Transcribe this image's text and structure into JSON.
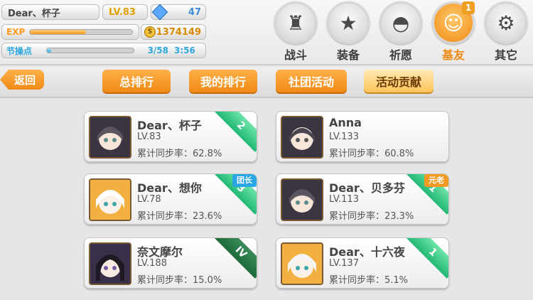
{
  "player": {
    "name": "Dear、杯子",
    "level": "LV.83",
    "gems": "47",
    "exp_label": "EXP",
    "exp_fraction": 0.55,
    "coins": "1374149",
    "stamina_label": "节操点",
    "stamina_fraction": 0.05,
    "stamina_value": "3/58",
    "stamina_timer": "3:56"
  },
  "nav": [
    {
      "label": "战斗",
      "icon": "castle-icon"
    },
    {
      "label": "装备",
      "icon": "star-gun-icon"
    },
    {
      "label": "祈愿",
      "icon": "egg-icon"
    },
    {
      "label": "基友",
      "icon": "friend-icon",
      "badge": "1"
    },
    {
      "label": "其它",
      "icon": "gear-icon"
    }
  ],
  "back_label": "返回",
  "tabs": [
    {
      "label": "总排行"
    },
    {
      "label": "我的排行"
    },
    {
      "label": "社团活动"
    },
    {
      "label": "活动贡献"
    }
  ],
  "members": [
    {
      "name": "Dear、杯子",
      "level": "LV.83",
      "rate": "累计同步率：62.8%",
      "rank": "2",
      "badge": ""
    },
    {
      "name": "Anna",
      "level": "LV.133",
      "rate": "累计同步率：60.8%",
      "rank": "",
      "badge": ""
    },
    {
      "name": "Dear、想你",
      "level": "LV.78",
      "rate": "累计同步率：23.6%",
      "rank": "3",
      "badge": "团长"
    },
    {
      "name": "Dear、贝多芬",
      "level": "LV.113",
      "rate": "累计同步率：23.3%",
      "rank": "1",
      "badge": "元老"
    },
    {
      "name": "奈文摩尔",
      "level": "LV.188",
      "rate": "累计同步率：15.0%",
      "rank": "IV",
      "badge": ""
    },
    {
      "name": "Dear、十六夜",
      "level": "LV.137",
      "rate": "累计同步率：5.1%",
      "rank": "1",
      "badge": ""
    }
  ],
  "colors": {
    "accent_orange": "#f08a14",
    "ribbon_green": "#20b873",
    "badge_blue": "#2aa6e6",
    "badge_orange": "#f39a22"
  }
}
